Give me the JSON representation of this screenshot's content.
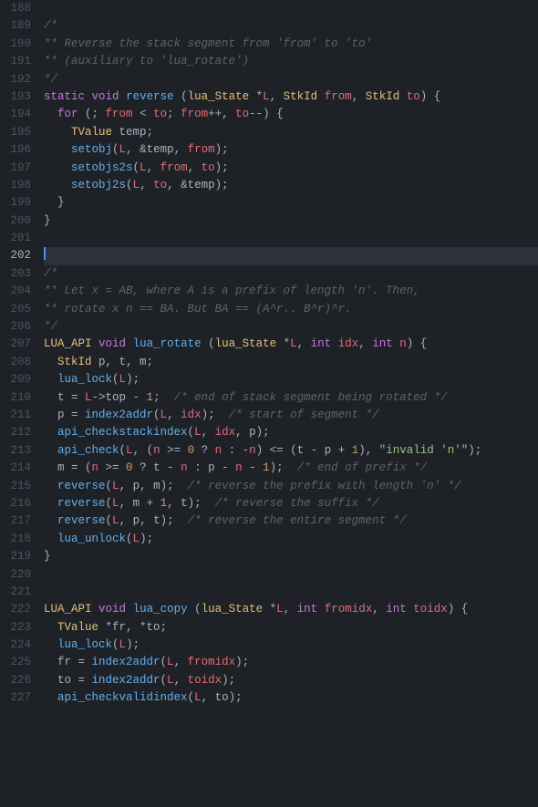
{
  "editor": {
    "background": "#1e2227",
    "lines": [
      {
        "num": 188,
        "content": "",
        "active": false
      },
      {
        "num": 189,
        "content": "/*",
        "active": false
      },
      {
        "num": 190,
        "content": "** Reverse the stack segment from 'from' to 'to'",
        "active": false
      },
      {
        "num": 191,
        "content": "** (auxiliary to 'lua_rotate')",
        "active": false
      },
      {
        "num": 192,
        "content": "*/",
        "active": false
      },
      {
        "num": 193,
        "content": "static void reverse (lua_State *L, StkId from, StkId to) {",
        "active": false
      },
      {
        "num": 194,
        "content": "  for (; from < to; from++, to--) {",
        "active": false
      },
      {
        "num": 195,
        "content": "    TValue temp;",
        "active": false
      },
      {
        "num": 196,
        "content": "    setobj(L, &temp, from);",
        "active": false
      },
      {
        "num": 197,
        "content": "    setobjs2s(L, from, to);",
        "active": false
      },
      {
        "num": 198,
        "content": "    setobj2s(L, to, &temp);",
        "active": false
      },
      {
        "num": 199,
        "content": "  }",
        "active": false
      },
      {
        "num": 200,
        "content": "}",
        "active": false
      },
      {
        "num": 201,
        "content": "",
        "active": false
      },
      {
        "num": 202,
        "content": "",
        "active": true
      },
      {
        "num": 203,
        "content": "/*",
        "active": false
      },
      {
        "num": 204,
        "content": "** Let x = AB, where A is a prefix of length 'n'. Then,",
        "active": false
      },
      {
        "num": 205,
        "content": "** rotate x n == BA. But BA == (A^r.. B^r)^r.",
        "active": false
      },
      {
        "num": 206,
        "content": "*/",
        "active": false
      },
      {
        "num": 207,
        "content": "LUA_API void lua_rotate (lua_State *L, int idx, int n) {",
        "active": false
      },
      {
        "num": 208,
        "content": "  StkId p, t, m;",
        "active": false
      },
      {
        "num": 209,
        "content": "  lua_lock(L);",
        "active": false
      },
      {
        "num": 210,
        "content": "  t = L->top - 1;  /* end of stack segment being rotated */",
        "active": false
      },
      {
        "num": 211,
        "content": "  p = index2addr(L, idx);  /* start of segment */",
        "active": false
      },
      {
        "num": 212,
        "content": "  api_checkstackindex(L, idx, p);",
        "active": false
      },
      {
        "num": 213,
        "content": "  api_check(L, (n >= 0 ? n : -n) <= (t - p + 1), \"invalid 'n'\");",
        "active": false
      },
      {
        "num": 214,
        "content": "  m = (n >= 0 ? t - n : p - n - 1);  /* end of prefix */",
        "active": false
      },
      {
        "num": 215,
        "content": "  reverse(L, p, m);  /* reverse the prefix with length 'n' */",
        "active": false
      },
      {
        "num": 216,
        "content": "  reverse(L, m + 1, t);  /* reverse the suffix */",
        "active": false
      },
      {
        "num": 217,
        "content": "  reverse(L, p, t);  /* reverse the entire segment */",
        "active": false
      },
      {
        "num": 218,
        "content": "  lua_unlock(L);",
        "active": false
      },
      {
        "num": 219,
        "content": "}",
        "active": false
      },
      {
        "num": 220,
        "content": "",
        "active": false
      },
      {
        "num": 221,
        "content": "",
        "active": false
      },
      {
        "num": 222,
        "content": "LUA_API void lua_copy (lua_State *L, int fromidx, int toidx) {",
        "active": false
      },
      {
        "num": 223,
        "content": "  TValue *fr, *to;",
        "active": false
      },
      {
        "num": 224,
        "content": "  lua_lock(L);",
        "active": false
      },
      {
        "num": 225,
        "content": "  fr = index2addr(L, fromidx);",
        "active": false
      },
      {
        "num": 226,
        "content": "  to = index2addr(L, toidx);",
        "active": false
      },
      {
        "num": 227,
        "content": "  api_checkvalidindex(L, to);",
        "active": false
      }
    ]
  }
}
